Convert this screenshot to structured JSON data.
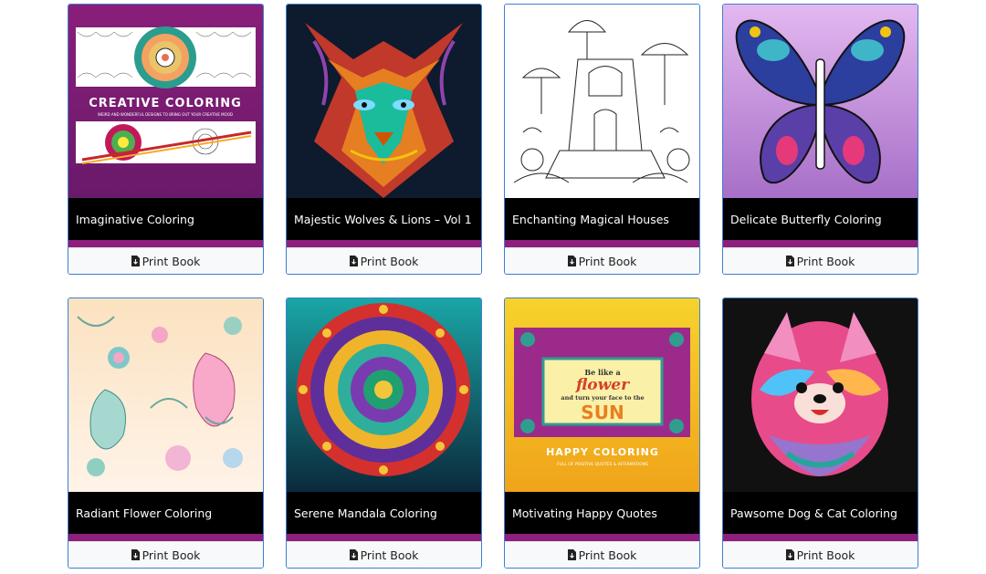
{
  "books": [
    {
      "title": "Imaginative Coloring",
      "button": "Print Book",
      "cover_text": "CREATIVE COLORING",
      "cover_subtext": "WEIRD AND WONDERFUL DESIGNS TO BRING OUT YOUR CREATIVE MOOD"
    },
    {
      "title": "Majestic Wolves & Lions – Vol 1",
      "button": "Print Book"
    },
    {
      "title": "Enchanting Magical Houses",
      "button": "Print Book"
    },
    {
      "title": "Delicate Butterfly Coloring",
      "button": "Print Book"
    },
    {
      "title": "Radiant Flower Coloring",
      "button": "Print Book"
    },
    {
      "title": "Serene Mandala Coloring",
      "button": "Print Book"
    },
    {
      "title": "Motivating Happy Quotes",
      "button": "Print Book",
      "cover_quote_1": "Be like a",
      "cover_quote_2": "flower",
      "cover_quote_3": "and turn your face to the",
      "cover_quote_4": "SUN",
      "cover_text": "HAPPY COLORING",
      "cover_subtext": "FULL OF POSITIVE QUOTES & AFFIRMATIONS"
    },
    {
      "title": "Pawsome Dog & Cat Coloring",
      "button": "Print Book"
    }
  ],
  "colors": {
    "accent": "#8e1f7c",
    "card_border": "#3d7fd1",
    "title_bg": "#000000"
  },
  "icons": {
    "print_button": "file-download-icon"
  }
}
